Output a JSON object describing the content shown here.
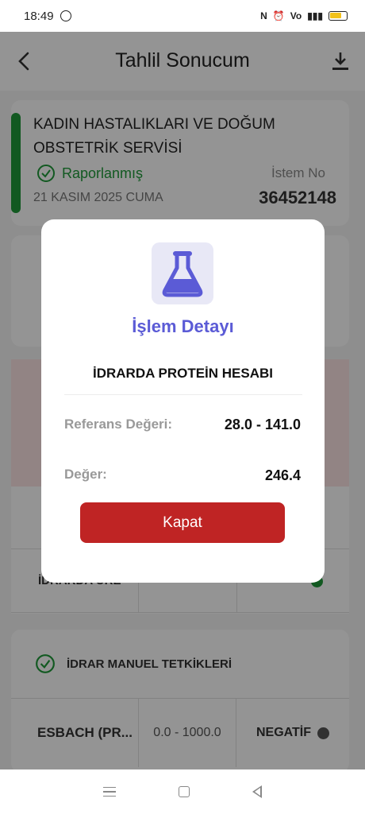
{
  "status_bar": {
    "time": "18:49",
    "icons": [
      "whatsapp-icon",
      "nfc-icon",
      "alarm-icon",
      "volte-icon",
      "signal-icon",
      "battery-icon"
    ],
    "volte_text": "Vo",
    "battery_color": "#f3c21b"
  },
  "app_bar": {
    "title": "Tahlil Sonucum"
  },
  "report": {
    "clinic": "KADIN HASTALIKLARI VE DOĞUM OBSTETRİK SERVİSİ",
    "status": "Raporlanmış",
    "date": "21 KASIM 2025 CUMA",
    "request_label": "İstem No",
    "request_no": "36452148",
    "status_color": "#1f9a3a"
  },
  "background_rows": {
    "partial_row_name": "İDRARDA ÜRE"
  },
  "manual_section": {
    "title": "İDRAR MANUEL TETKİKLERİ",
    "rows": [
      {
        "name": "ESBACH (PR...",
        "reference": "0.0 - 1000.0",
        "value": "NEGATİF"
      }
    ]
  },
  "dialog": {
    "title": "İşlem Detayı",
    "test_name": "İDRARDA PROTEİN HESABI",
    "reference_label": "Referans Değeri:",
    "reference_value": "28.0 - 141.0",
    "value_label": "Değer:",
    "value": "246.4",
    "close_label": "Kapat",
    "accent_color": "#5b5bd6",
    "button_color": "#bf2424"
  }
}
